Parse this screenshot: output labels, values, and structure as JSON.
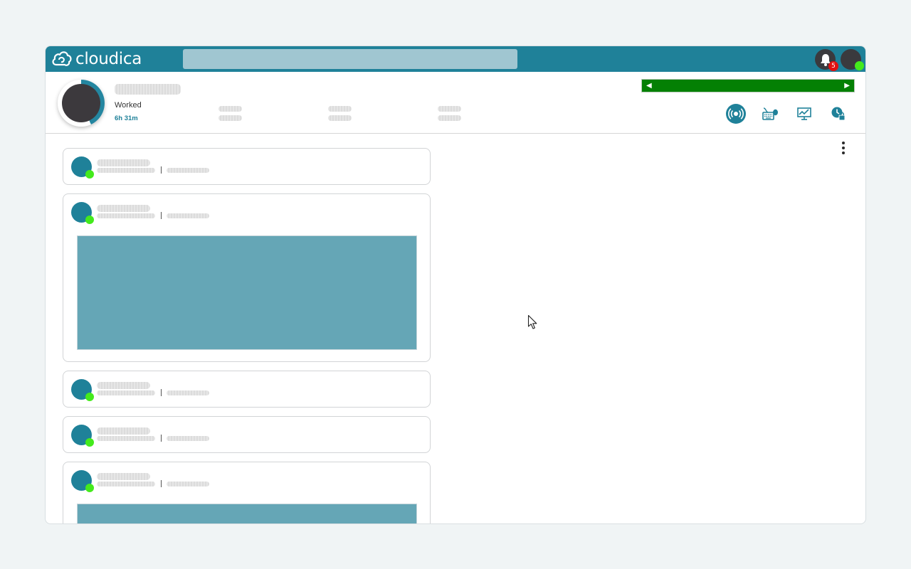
{
  "app": {
    "brand_name": "cloudica",
    "brand_color": "#1f8199",
    "search_value": ""
  },
  "topbar": {
    "notifications_icon": "bell-icon",
    "notifications_count": "5",
    "user_status": "online",
    "status_color": "#44ea1c"
  },
  "profile": {
    "worked_label": "Worked",
    "worked_value": "6h 31m",
    "progress_fraction": 0.43
  },
  "timeline": {
    "color": "#048004",
    "prev_icon": "triangle-left-icon",
    "next_icon": "triangle-right-icon"
  },
  "toolbar": {
    "icons": [
      "broadcast-icon",
      "keyboard-mouse-icon",
      "monitor-activity-icon",
      "clock-lock-icon"
    ],
    "active_index": 0
  },
  "feed": {
    "menu_icon": "more-vertical-icon",
    "items": [
      {
        "has_screenshot": false,
        "status": "online"
      },
      {
        "has_screenshot": true,
        "status": "online"
      },
      {
        "has_screenshot": false,
        "status": "online"
      },
      {
        "has_screenshot": false,
        "status": "online"
      },
      {
        "has_screenshot": true,
        "status": "online"
      }
    ]
  }
}
